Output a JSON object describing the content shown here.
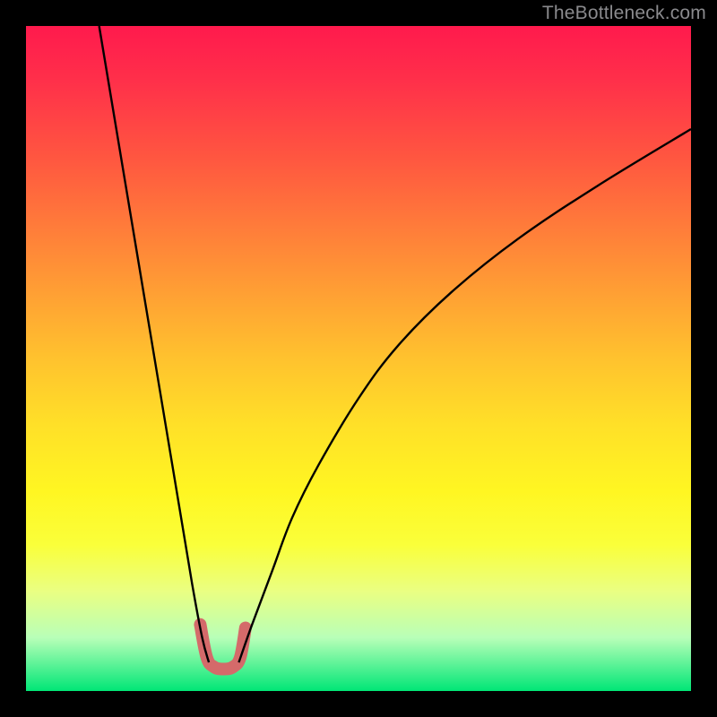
{
  "header": {
    "attribution": "TheBottleneck.com"
  },
  "chart_data": {
    "type": "line",
    "title": "",
    "xlabel": "",
    "ylabel": "",
    "xlim": [
      0,
      100
    ],
    "ylim": [
      0,
      100
    ],
    "series": [
      {
        "name": "left-branch",
        "x": [
          11.0,
          13.0,
          15.0,
          17.0,
          19.0,
          21.0,
          23.0,
          25.0,
          26.5,
          27.5
        ],
        "y": [
          100.0,
          88.0,
          76.0,
          64.0,
          52.0,
          40.0,
          28.0,
          16.0,
          8.0,
          4.3
        ]
      },
      {
        "name": "right-branch",
        "x": [
          32.0,
          34.0,
          37.0,
          40.0,
          44.0,
          50.0,
          56.0,
          64.0,
          74.0,
          86.0,
          100.0
        ],
        "y": [
          4.3,
          10.0,
          18.0,
          26.0,
          34.0,
          44.0,
          52.0,
          60.0,
          68.0,
          76.0,
          84.5
        ]
      },
      {
        "name": "optimal-zone-highlight",
        "x": [
          26.2,
          27.2,
          28.3,
          29.7,
          31.1,
          32.2,
          33.0
        ],
        "y": [
          10.0,
          5.0,
          3.6,
          3.3,
          3.6,
          5.0,
          9.5
        ]
      }
    ],
    "background": {
      "type": "vertical-gradient",
      "stops": [
        {
          "pos": 0.0,
          "color": "#ff1a4d"
        },
        {
          "pos": 0.5,
          "color": "#ffc22e"
        },
        {
          "pos": 0.8,
          "color": "#faff3a"
        },
        {
          "pos": 1.0,
          "color": "#00e676"
        }
      ]
    }
  }
}
